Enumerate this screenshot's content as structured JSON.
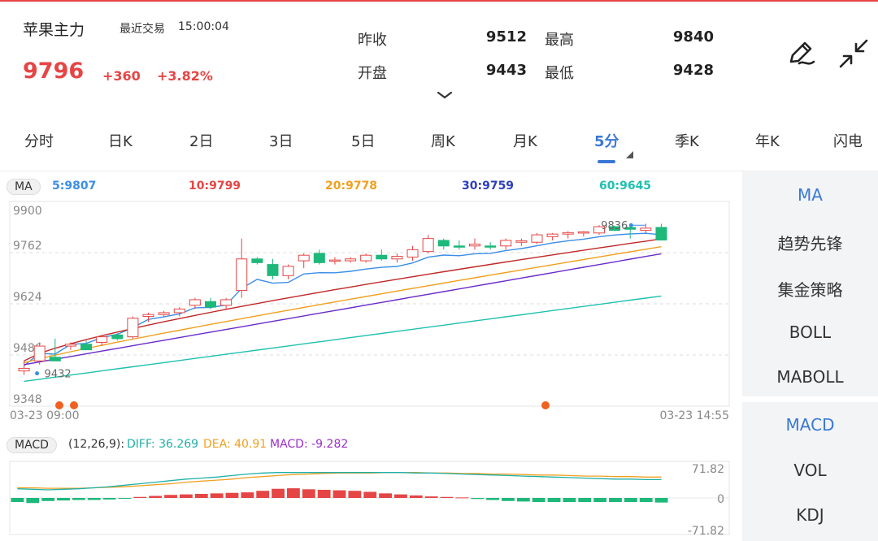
{
  "header": {
    "title": "苹果主力",
    "trade_label": "最近交易",
    "trade_time": "15:00:04",
    "price": "9796",
    "change": "+360",
    "change_pct": "+3.82%"
  },
  "quote": {
    "prev_close_label": "昨收",
    "prev_close": "9512",
    "high_label": "最高",
    "high": "9840",
    "open_label": "开盘",
    "open": "9443",
    "low_label": "最低",
    "low": "9428"
  },
  "tools": {
    "draw_icon": "pen-draw-icon",
    "collapse_icon": "collapse-arrows-icon"
  },
  "tabs": [
    {
      "label": "分时"
    },
    {
      "label": "日K"
    },
    {
      "label": "2日"
    },
    {
      "label": "3日"
    },
    {
      "label": "5日"
    },
    {
      "label": "周K"
    },
    {
      "label": "月K"
    },
    {
      "label": "5分",
      "active": true
    },
    {
      "label": "季K"
    },
    {
      "label": "年K"
    },
    {
      "label": "闪电"
    }
  ],
  "ma_legend": {
    "tag": "MA",
    "items": [
      {
        "label": "5:9807",
        "color": "#3a8ee6"
      },
      {
        "label": "10:9799",
        "color": "#e64545"
      },
      {
        "label": "20:9778",
        "color": "#f0a020"
      },
      {
        "label": "30:9759",
        "color": "#2d3fbf"
      },
      {
        "label": "60:9645",
        "color": "#20c0b0"
      }
    ]
  },
  "side_menu": {
    "top": [
      {
        "label": "MA",
        "active": true
      },
      {
        "label": "趋势先锋"
      },
      {
        "label": "集金策略"
      },
      {
        "label": "BOLL"
      },
      {
        "label": "MABOLL"
      }
    ],
    "bottom": [
      {
        "label": "MACD",
        "active": true
      },
      {
        "label": "VOL"
      },
      {
        "label": "KDJ"
      }
    ]
  },
  "macd_legend": {
    "tag": "MACD",
    "params": "(12,26,9):",
    "diff": "DIFF: 36.269",
    "dea": "DEA: 40.91",
    "macd": "MACD: -9.282",
    "diff_color": "#20b0a8",
    "dea_color": "#f0a020",
    "macd_color": "#9a2ec8"
  },
  "chart_data": [
    {
      "type": "candlestick",
      "y_ticks": [
        "9900",
        "9762",
        "9624",
        "9486",
        "9348"
      ],
      "ylim": [
        9348,
        9900
      ],
      "x_start": "03-23 09:00",
      "x_end": "03-23 14:55",
      "max_marker": "9836",
      "min_marker": "9432",
      "up_color": "#e64545",
      "down_color": "#1db87a",
      "candles": [
        [
          9443,
          9470,
          9432,
          9450
        ],
        [
          9470,
          9520,
          9460,
          9510
        ],
        [
          9480,
          9530,
          9470,
          9470
        ],
        [
          9510,
          9520,
          9500,
          9515
        ],
        [
          9515,
          9525,
          9500,
          9500
        ],
        [
          9520,
          9540,
          9510,
          9535
        ],
        [
          9540,
          9545,
          9525,
          9530
        ],
        [
          9535,
          9590,
          9530,
          9585
        ],
        [
          9590,
          9600,
          9575,
          9595
        ],
        [
          9595,
          9605,
          9590,
          9600
        ],
        [
          9600,
          9615,
          9590,
          9610
        ],
        [
          9620,
          9640,
          9610,
          9635
        ],
        [
          9630,
          9640,
          9610,
          9615
        ],
        [
          9620,
          9640,
          9610,
          9635
        ],
        [
          9660,
          9800,
          9640,
          9745
        ],
        [
          9745,
          9750,
          9730,
          9735
        ],
        [
          9730,
          9745,
          9690,
          9700
        ],
        [
          9700,
          9730,
          9690,
          9725
        ],
        [
          9740,
          9760,
          9720,
          9755
        ],
        [
          9760,
          9770,
          9730,
          9735
        ],
        [
          9740,
          9750,
          9730,
          9742
        ],
        [
          9740,
          9750,
          9735,
          9745
        ],
        [
          9740,
          9760,
          9735,
          9755
        ],
        [
          9755,
          9770,
          9740,
          9745
        ],
        [
          9745,
          9760,
          9735,
          9752
        ],
        [
          9750,
          9780,
          9740,
          9770
        ],
        [
          9765,
          9810,
          9760,
          9800
        ],
        [
          9795,
          9800,
          9770,
          9780
        ],
        [
          9780,
          9795,
          9770,
          9777
        ],
        [
          9780,
          9800,
          9770,
          9785
        ],
        [
          9780,
          9790,
          9770,
          9778
        ],
        [
          9780,
          9800,
          9770,
          9795
        ],
        [
          9790,
          9800,
          9780,
          9794
        ],
        [
          9790,
          9815,
          9785,
          9810
        ],
        [
          9805,
          9815,
          9795,
          9812
        ],
        [
          9812,
          9820,
          9800,
          9816
        ],
        [
          9816,
          9820,
          9805,
          9818
        ],
        [
          9815,
          9836,
          9810,
          9832
        ],
        [
          9832,
          9835,
          9820,
          9822
        ],
        [
          9830,
          9835,
          9800,
          9825
        ],
        [
          9822,
          9840,
          9815,
          9828
        ],
        [
          9830,
          9840,
          9810,
          9796
        ]
      ],
      "ma_series": [
        {
          "name": "5",
          "color": "#3a8ee6",
          "first": 9470,
          "last": 9807
        },
        {
          "name": "10",
          "color": "#c02828",
          "first": 9470,
          "last": 9799
        },
        {
          "name": "20",
          "color": "#f0a020",
          "first": 9465,
          "last": 9778
        },
        {
          "name": "30",
          "color": "#6a2cc8",
          "first": 9460,
          "last": 9759
        },
        {
          "name": "60",
          "color": "#20c0b0",
          "first": 9415,
          "last": 9645
        }
      ]
    },
    {
      "type": "bar",
      "name": "MACD",
      "y_ticks": [
        "71.82",
        "0",
        "-71.82"
      ],
      "ylim": [
        -71.82,
        71.82
      ],
      "histogram": [
        -8,
        -10,
        -6,
        -5,
        -4,
        -4,
        -3,
        -1,
        2,
        4,
        6,
        7,
        8,
        9,
        10,
        11,
        14,
        18,
        19,
        17,
        16,
        15,
        14,
        12,
        9,
        7,
        5,
        3,
        2,
        1,
        -2,
        -4,
        -6,
        -7,
        -8,
        -8,
        -8,
        -8,
        -8,
        -8,
        -8,
        -8,
        -9
      ],
      "diff": [
        18,
        17,
        16,
        17,
        18,
        20,
        22,
        25,
        28,
        31,
        34,
        37,
        39,
        41,
        44,
        47,
        49,
        50,
        50,
        50,
        50,
        50,
        50,
        50,
        50,
        50,
        49,
        49,
        48,
        47,
        46,
        45,
        44,
        43,
        42,
        41,
        40,
        39,
        38,
        37,
        37,
        36,
        36
      ],
      "dea": [
        20,
        20,
        19,
        19,
        19,
        20,
        21,
        22,
        24,
        26,
        28,
        31,
        33,
        35,
        37,
        40,
        42,
        44,
        46,
        47,
        48,
        49,
        49,
        49,
        50,
        50,
        50,
        49,
        49,
        48,
        48,
        47,
        47,
        46,
        45,
        45,
        44,
        43,
        43,
        42,
        42,
        41,
        41
      ]
    }
  ]
}
